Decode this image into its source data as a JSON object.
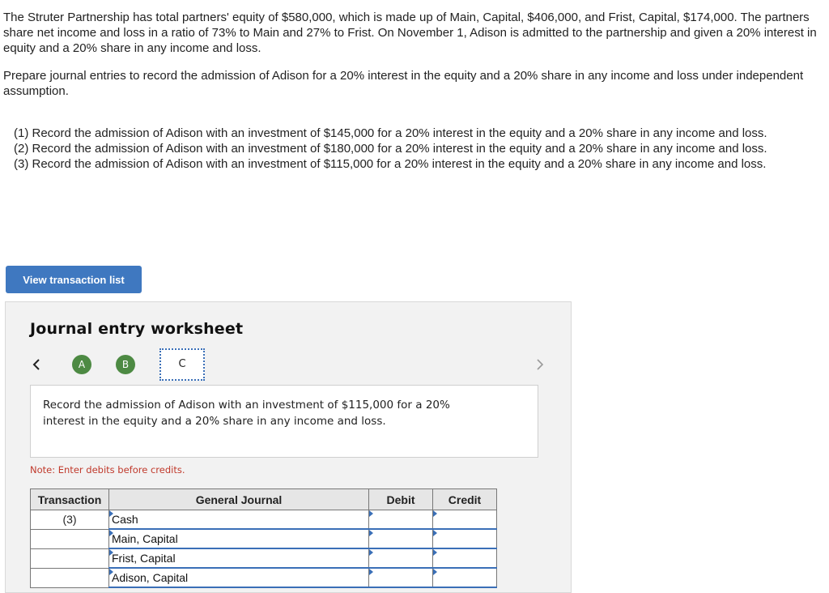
{
  "problem": {
    "intro": "The Struter Partnership has total partners' equity of $580,000, which is made up of Main, Capital, $406,000, and Frist, Capital, $174,000. The partners share net income and loss in a ratio of 73% to Main and 27% to Frist. On November 1, Adison is admitted to the partnership and given a 20% interest in equity and a 20% share in any income and loss.",
    "instruction": "Prepare journal entries to record the admission of Adison for a 20% interest in the equity and a 20% share in any income and loss under independent assumption.",
    "requirements": [
      "(1) Record the admission of Adison with an investment of $145,000 for a 20% interest in the equity and a 20% share in any income and loss.",
      "(2) Record the admission of Adison with an investment of $180,000 for a 20% interest in the equity and a 20% share in any income and loss.",
      "(3) Record the admission of Adison with an investment of $115,000 for a 20% interest in the equity and a 20% share in any income and loss."
    ]
  },
  "view_button_label": "View transaction list",
  "worksheet": {
    "title": "Journal entry worksheet",
    "prev_glyph": "<",
    "next_glyph": ">",
    "steps": [
      {
        "label": "A",
        "status": "complete",
        "color": "#4d8a43"
      },
      {
        "label": "B",
        "status": "complete",
        "color": "#4d8a43"
      },
      {
        "label": "C",
        "status": "current"
      }
    ],
    "instruction": "Record the admission of Adison with an investment of $115,000 for a 20% interest in the equity and a 20% share in any income and loss.",
    "note": "Note: Enter debits before credits.",
    "note_color": "#c0392b",
    "table": {
      "headers": [
        "Transaction",
        "General Journal",
        "Debit",
        "Credit"
      ],
      "rows": [
        {
          "transaction": "(3)",
          "account": "Cash",
          "debit": "",
          "credit": ""
        },
        {
          "transaction": "",
          "account": "Main, Capital",
          "debit": "",
          "credit": ""
        },
        {
          "transaction": "",
          "account": "Frist, Capital",
          "debit": "",
          "credit": ""
        },
        {
          "transaction": "",
          "account": "Adison, Capital",
          "debit": "",
          "credit": ""
        }
      ]
    }
  },
  "colors": {
    "button_bg": "#3f78c0",
    "input_accent": "#3a6fb7",
    "worksheet_bg": "#f2f2f2",
    "header_bg": "#e6e6e6"
  }
}
